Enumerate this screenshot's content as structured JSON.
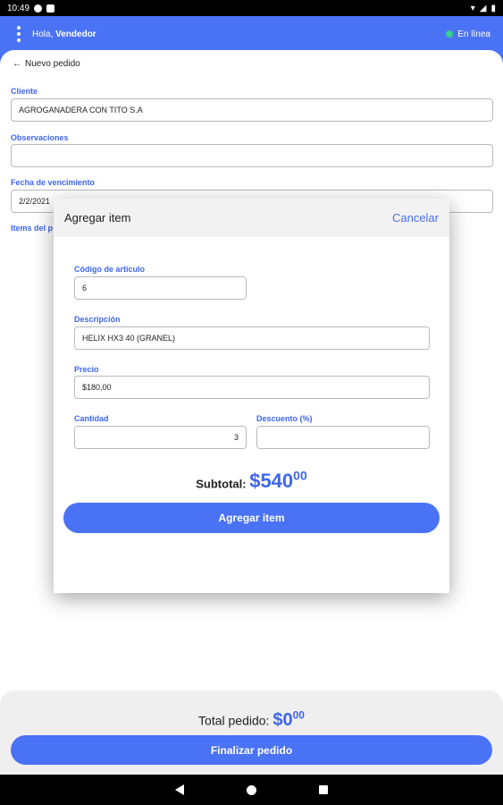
{
  "status_bar": {
    "time": "10:49"
  },
  "header": {
    "greeting_prefix": "Hola, ",
    "user": "Vendedor",
    "status": "En línea",
    "status_color": "#35d08a",
    "accent": "#4a72f5"
  },
  "form": {
    "back_label": "Nuevo pedido",
    "client_label": "Cliente",
    "client_value": "AGROGANADERA CON TITO S.A",
    "observations_label": "Observaciones",
    "observations_value": "",
    "due_date_label": "Fecha de vencimiento",
    "due_date_value": "2/2/2021",
    "items_label": "Items del p"
  },
  "dialog": {
    "title": "Agregar item",
    "cancel": "Cancelar",
    "code_label": "Código de articulo",
    "code_value": "6",
    "description_label": "Descripción",
    "description_value": "HELIX HX3 40 (GRANEL)",
    "price_label": "Precio",
    "price_value": "$180,00",
    "quantity_label": "Cantidad",
    "quantity_value": "3",
    "discount_label": "Descuento (%)",
    "discount_value": "",
    "subtotal_label": "Subtotal:",
    "subtotal_amount": "$540",
    "subtotal_cents": "00",
    "add_button": "Agregar item"
  },
  "footer": {
    "total_label": "Total pedido:",
    "total_amount": "$0",
    "total_cents": "00",
    "finalize_button": "Finalizar pedido"
  }
}
